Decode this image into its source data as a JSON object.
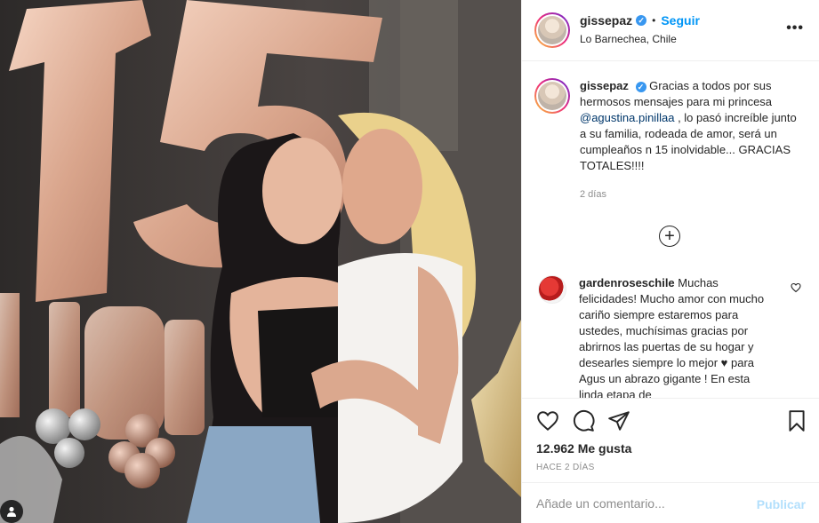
{
  "post": {
    "username": "gissepaz",
    "verified": true,
    "follow_label": "Seguir",
    "dot": "•",
    "location": "Lo Barnechea, Chile",
    "more_label": "•••"
  },
  "caption": {
    "username": "gissepaz",
    "text_before_mention": "Gracias a todos por sus hermosos mensajes para mi princesa",
    "mention": "@agustina.pinillaa",
    "text_after_mention": ", lo pasó increíble junto a su familia, rodeada de amor, será un cumpleaños n 15 inolvidable... GRACIAS TOTALES!!!!",
    "time": "2 días"
  },
  "load_more_label": "+",
  "comments": [
    {
      "username": "gardenroseschile",
      "text": "Muchas felicidades! Mucho amor con mucho cariño siempre estaremos para ustedes, muchísimas gracias por abrirnos las puertas de su hogar y desearles siempre lo mejor ♥ para Agus un abrazo gigante ! En esta linda etapa de"
    }
  ],
  "actions": {
    "likes": "12.962 Me gusta",
    "date": "HACE 2 DÍAS"
  },
  "add_comment": {
    "placeholder": "Añade un comentario...",
    "publish_label": "Publicar"
  },
  "icons": {
    "like": "heart-icon",
    "comment": "comment-bubble-icon",
    "share": "paper-plane-icon",
    "save": "bookmark-icon",
    "user_tag": "user-tag-icon"
  },
  "colors": {
    "accent": "#0095f6",
    "verified": "#3897f0",
    "mention": "#00376b",
    "muted": "#8e8e8e",
    "publish_disabled": "#b2dffc"
  }
}
